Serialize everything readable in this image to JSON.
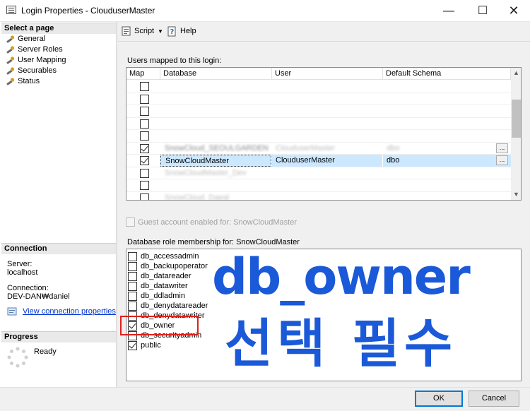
{
  "window": {
    "title": "Login Properties - ClouduserMaster",
    "minimize": "—",
    "maximize": "☐",
    "close": "✕"
  },
  "left": {
    "select_page_header": "Select a page",
    "pages": [
      "General",
      "Server Roles",
      "User Mapping",
      "Securables",
      "Status"
    ],
    "connection_header": "Connection",
    "server_label": "Server:",
    "server_value": "localhost",
    "connection_label": "Connection:",
    "connection_value": "DEV-DAN₩daniel",
    "view_link": "View connection properties",
    "progress_header": "Progress",
    "progress_status": "Ready"
  },
  "toolbar": {
    "script_label": "Script",
    "help_label": "Help"
  },
  "mapping": {
    "section_label": "Users mapped to this login:",
    "columns": [
      "Map",
      "Database",
      "User",
      "Default Schema"
    ],
    "rows": [
      {
        "checked": false,
        "database": "",
        "user": "",
        "schema": ""
      },
      {
        "checked": false,
        "database": "",
        "user": "",
        "schema": ""
      },
      {
        "checked": false,
        "database": "",
        "user": "",
        "schema": ""
      },
      {
        "checked": false,
        "database": "",
        "user": "",
        "schema": ""
      },
      {
        "checked": false,
        "database": "",
        "user": "",
        "schema": ""
      },
      {
        "checked": true,
        "database": "SnowCloud_SEOULGARDEN",
        "user": "ClouduserMaster",
        "schema": "dbo"
      },
      {
        "checked": true,
        "database": "SnowCloudMaster",
        "user": "ClouduserMaster",
        "schema": "dbo"
      },
      {
        "checked": false,
        "database": "SnowCloudMaster_Dev",
        "user": "",
        "schema": ""
      },
      {
        "checked": false,
        "database": "",
        "user": "",
        "schema": ""
      },
      {
        "checked": false,
        "database": "SnowCloud_Daeal",
        "user": "",
        "schema": ""
      }
    ],
    "guest_label": "Guest account enabled for: SnowCloudMaster"
  },
  "roles": {
    "section_label": "Database role membership for: SnowCloudMaster",
    "items": [
      {
        "name": "db_accessadmin",
        "checked": false
      },
      {
        "name": "db_backupoperator",
        "checked": false
      },
      {
        "name": "db_datareader",
        "checked": false
      },
      {
        "name": "db_datawriter",
        "checked": false
      },
      {
        "name": "db_ddladmin",
        "checked": false
      },
      {
        "name": "db_denydatareader",
        "checked": false
      },
      {
        "name": "db_denydatawriter",
        "checked": false
      },
      {
        "name": "db_owner",
        "checked": true
      },
      {
        "name": "db_securityadmin",
        "checked": false
      },
      {
        "name": "public",
        "checked": true
      }
    ]
  },
  "annotation": {
    "line1": "db_owner",
    "line2": "선택 필수",
    "color": "#1a59d8",
    "highlight_color": "#e0201b"
  },
  "buttons": {
    "ok": "OK",
    "cancel": "Cancel"
  }
}
